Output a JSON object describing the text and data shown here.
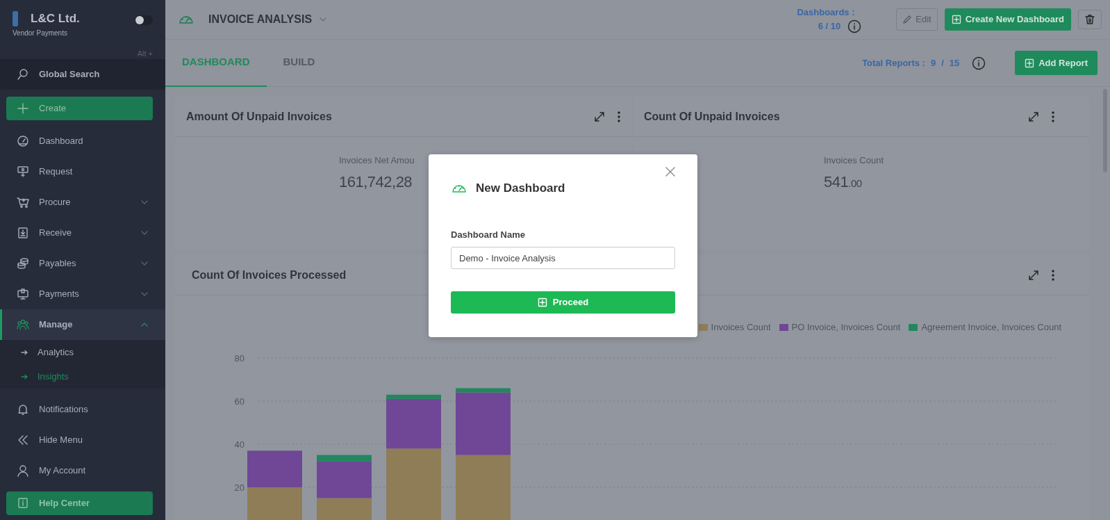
{
  "sidebar": {
    "brand": {
      "name": "L&C Ltd.",
      "subtitle": "Vendor Payments"
    },
    "theme_toggle": {
      "on": false
    },
    "shortcut_hint": "Alt +",
    "items": [
      {
        "kind": "search",
        "label": "Global Search",
        "selected": false
      },
      {
        "kind": "create",
        "label": "Create",
        "selected": false
      },
      {
        "kind": "item",
        "label": "Dashboard",
        "selected": false
      },
      {
        "kind": "item",
        "label": "Request",
        "selected": false
      },
      {
        "kind": "group",
        "label": "Procure",
        "selected": false,
        "expanded": false
      },
      {
        "kind": "group",
        "label": "Receive",
        "selected": false,
        "expanded": false
      },
      {
        "kind": "group",
        "label": "Payables",
        "selected": false,
        "expanded": false
      },
      {
        "kind": "group",
        "label": "Payments",
        "selected": false,
        "expanded": false
      },
      {
        "kind": "group",
        "label": "Manage",
        "selected": true,
        "expanded": true,
        "children": [
          {
            "label": "Analytics",
            "selected": false
          },
          {
            "label": "Insights",
            "selected": true
          }
        ]
      },
      {
        "kind": "item",
        "label": "Notifications",
        "selected": false
      },
      {
        "kind": "item",
        "label": "Hide Menu",
        "selected": false
      },
      {
        "kind": "item",
        "label": "My Account",
        "selected": false
      },
      {
        "kind": "help",
        "label": "Help Center",
        "selected": false
      }
    ]
  },
  "header": {
    "title": "INVOICE ANALYSIS",
    "dashboards_label": "Dashboards :",
    "dashboards_count": "6 / 10",
    "buttons": [
      {
        "kind": "edit",
        "label": "Edit"
      },
      {
        "kind": "create",
        "label": "Create New Dashboard"
      },
      {
        "kind": "delete"
      }
    ]
  },
  "tabs": [
    {
      "label": "DASHBOARD",
      "selected": true
    },
    {
      "label": "BUILD",
      "selected": false
    }
  ],
  "reports": {
    "label": "Total Reports :",
    "used": "9",
    "separator": "/",
    "total": "15",
    "button": "Add Report"
  },
  "cards": [
    {
      "title": "Amount Of Unpaid Invoices",
      "metric_label": "Invoices Net Amou",
      "metric_value": "161,742,28"
    },
    {
      "title": "Count Of Unpaid Invoices",
      "metric_label": "Invoices Count",
      "metric_value": "541",
      "metric_decimals": ".00"
    }
  ],
  "chart_card": {
    "title": "Count Of Invoices Processed",
    "chart_data": {
      "type": "bar",
      "stacked": true,
      "grid": true,
      "ylim": [
        0,
        80
      ],
      "yticks": [
        20,
        40,
        60,
        80
      ],
      "series": [
        {
          "name": "Invoices Count",
          "color": "#8f7d58",
          "values": [
            20,
            15,
            38,
            35
          ]
        },
        {
          "name": "PO Invoice, Invoices Count",
          "color": "#6f4796",
          "values": [
            17,
            17,
            23,
            29
          ]
        },
        {
          "name": "Agreement Invoice, Invoices Count",
          "color": "#23865f",
          "values": [
            0,
            3,
            2,
            2
          ]
        }
      ]
    }
  },
  "modal": {
    "title": "New Dashboard",
    "field_label": "Dashboard Name",
    "field_value": "Demo - Invoice Analysis",
    "button": "Proceed"
  }
}
